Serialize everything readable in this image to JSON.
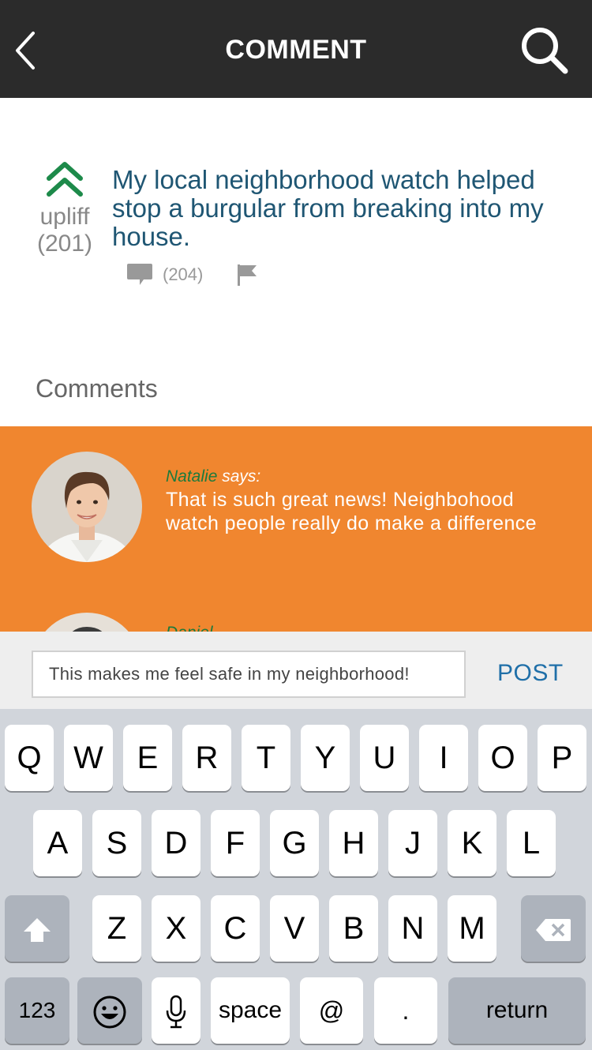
{
  "nav": {
    "title": "COMMENT"
  },
  "post": {
    "vote_label": "upliff",
    "vote_count": "(201)",
    "text": "My local neighborhood watch helped stop a burgular from breaking into my house.",
    "comment_count": "(204)"
  },
  "comments_heading": "Comments",
  "comments": [
    {
      "author": "Natalie",
      "says": " says:",
      "body": "That is such great news! Neighbohood watch people really do make a difference"
    },
    {
      "author": "Daniel",
      "says": "",
      "body": ""
    }
  ],
  "composer": {
    "value": "This makes me feel safe in my neighborhood!",
    "post_label": "POST"
  },
  "keyboard": {
    "row1": [
      "Q",
      "W",
      "E",
      "R",
      "T",
      "Y",
      "U",
      "I",
      "O",
      "P"
    ],
    "row2": [
      "A",
      "S",
      "D",
      "F",
      "G",
      "H",
      "J",
      "K",
      "L"
    ],
    "row3": [
      "Z",
      "X",
      "C",
      "V",
      "B",
      "N",
      "M"
    ],
    "numbers_label": "123",
    "space_label": "space",
    "at_label": "@",
    "period_label": ".",
    "return_label": "return"
  },
  "colors": {
    "navbar": "#2b2b2b",
    "accent_orange": "#f0862f",
    "title_blue": "#1f5673",
    "upvote_green": "#1d8a4a",
    "author_green": "#1d7a3c",
    "post_button_blue": "#1f6fa8"
  },
  "icons": [
    "back-chevron-icon",
    "search-icon",
    "upvote-chevron-icon",
    "comment-bubble-icon",
    "flag-icon",
    "shift-icon",
    "backspace-icon",
    "emoji-icon",
    "microphone-icon"
  ]
}
